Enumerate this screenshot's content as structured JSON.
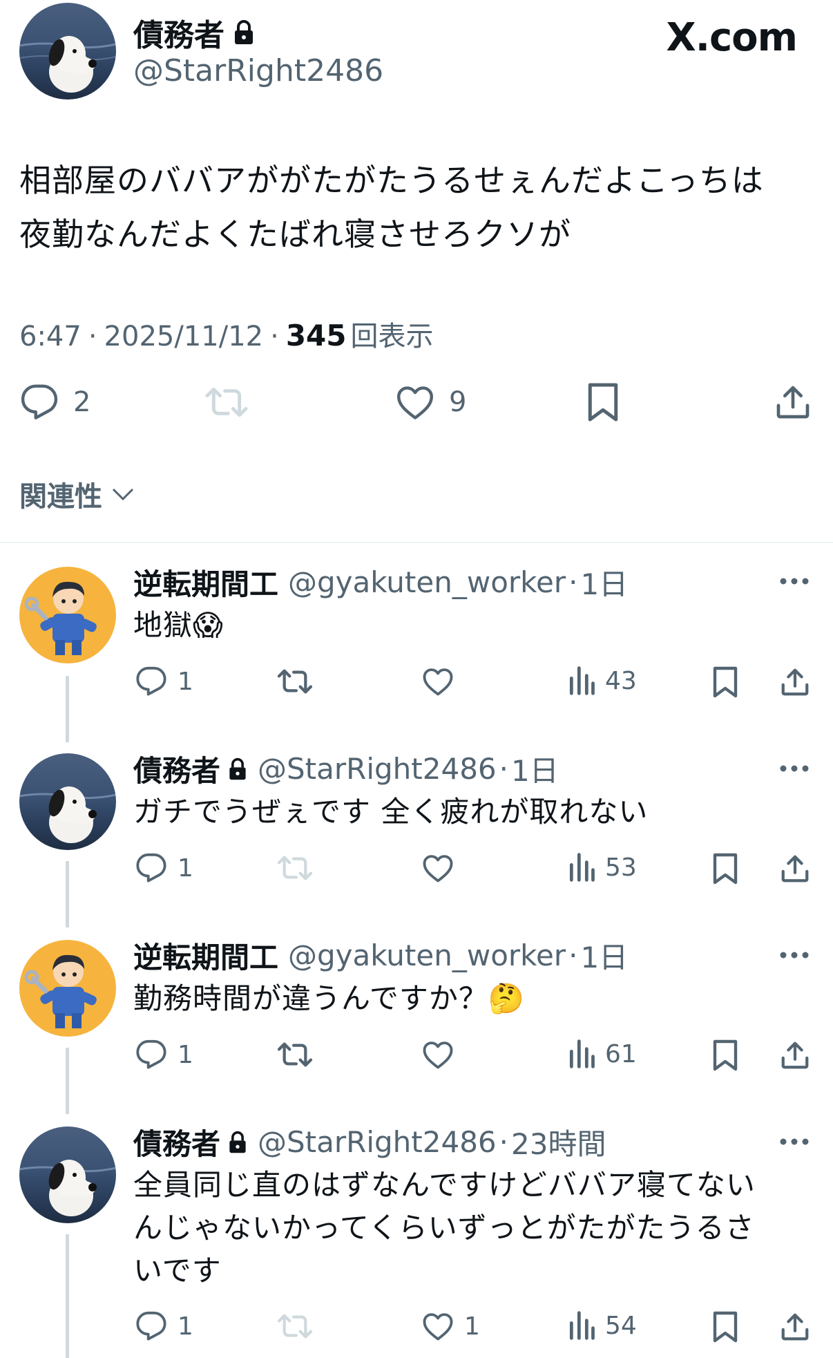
{
  "main": {
    "author_name": "債務者",
    "handle": "@StarRight2486",
    "brand": "X.com",
    "text_lines": [
      "相部屋のババアががたがたうるせぇんだよこっちは",
      "夜勤なんだよくたばれ寝させろクソが"
    ],
    "time": "6:47",
    "dot": "·",
    "date": "2025/11/12",
    "views_count": "345",
    "views_label": "回表示",
    "reply_count": "2",
    "like_count": "9"
  },
  "relevance_label": "関連性",
  "replies": [
    {
      "name": "逆転期間工",
      "handle": "@gyakuten_worker",
      "time": "1日",
      "text_lines": [
        "地獄😱"
      ],
      "reply_count": "1",
      "retweet_count": "",
      "like_count": "",
      "views": "43",
      "locked": false
    },
    {
      "name": "債務者",
      "handle": "@StarRight2486",
      "time": "1日",
      "text_lines": [
        "ガチでうぜぇです 全く疲れが取れない"
      ],
      "reply_count": "1",
      "retweet_count": "",
      "like_count": "",
      "views": "53",
      "locked": true
    },
    {
      "name": "逆転期間工",
      "handle": "@gyakuten_worker",
      "time": "1日",
      "text_lines": [
        "勤務時間が違うんですか？🤔"
      ],
      "reply_count": "1",
      "retweet_count": "",
      "like_count": "",
      "views": "61",
      "locked": false
    },
    {
      "name": "債務者",
      "handle": "@StarRight2486",
      "time": "23時間",
      "text_lines": [
        "全員同じ直のはずなんですけどババア寝てない",
        "んじゃないかってくらいずっとがたがたうるさ",
        "いです"
      ],
      "reply_count": "1",
      "retweet_count": "",
      "like_count": "1",
      "views": "54",
      "locked": true
    }
  ],
  "colors": {
    "text": "#0f1419",
    "muted": "#536471",
    "disabled": "#cfd9de",
    "line": "#cfd9de",
    "worker_bg": "#f6b43e"
  },
  "icons": [
    "lock-icon",
    "reply-icon",
    "retweet-icon",
    "like-icon",
    "bookmark-icon",
    "share-icon",
    "views-icon",
    "more-icon",
    "chevron-down-icon"
  ]
}
